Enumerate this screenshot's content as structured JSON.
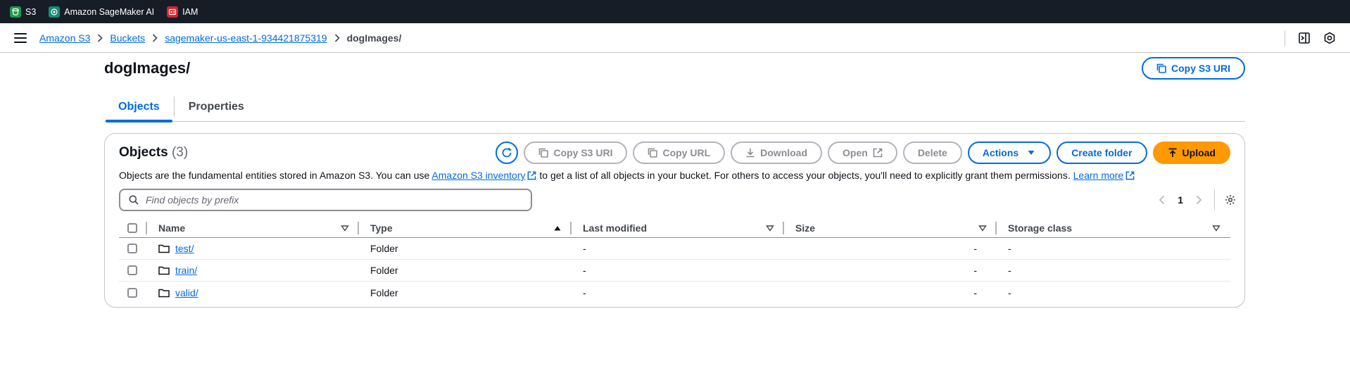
{
  "topbar": {
    "services": [
      {
        "label": "S3",
        "icon": "s3-icon",
        "color": "#1b9a4b"
      },
      {
        "label": "Amazon SageMaker AI",
        "icon": "sagemaker-icon",
        "color": "#158c77"
      },
      {
        "label": "IAM",
        "icon": "iam-icon",
        "color": "#d6242d"
      }
    ]
  },
  "breadcrumb": {
    "items": [
      "Amazon S3",
      "Buckets",
      "sagemaker-us-east-1-934421875319"
    ],
    "current": "dogImages/"
  },
  "page": {
    "title": "dogImages/",
    "copy_uri_label": "Copy S3 URI"
  },
  "tabs": [
    {
      "label": "Objects",
      "active": true
    },
    {
      "label": "Properties",
      "active": false
    }
  ],
  "objects_panel": {
    "title": "Objects",
    "count": "(3)",
    "toolbar": {
      "copy_s3_uri": "Copy S3 URI",
      "copy_url": "Copy URL",
      "download": "Download",
      "open": "Open",
      "delete": "Delete",
      "actions": "Actions",
      "create_folder": "Create folder",
      "upload": "Upload"
    },
    "description_pre": "Objects are the fundamental entities stored in Amazon S3. You can use ",
    "inventory_link": "Amazon S3 inventory",
    "description_post": " to get a list of all objects in your bucket. For others to access your objects, you'll need to explicitly grant them permissions. ",
    "learn_more": "Learn more",
    "search_placeholder": "Find objects by prefix",
    "page_number": "1"
  },
  "table": {
    "columns": [
      "Name",
      "Type",
      "Last modified",
      "Size",
      "Storage class"
    ],
    "rows": [
      {
        "name": "test/",
        "type": "Folder",
        "last_modified": "-",
        "size": "-",
        "storage_class": "-"
      },
      {
        "name": "train/",
        "type": "Folder",
        "last_modified": "-",
        "size": "-",
        "storage_class": "-"
      },
      {
        "name": "valid/",
        "type": "Folder",
        "last_modified": "-",
        "size": "-",
        "storage_class": "-"
      }
    ]
  },
  "colors": {
    "link": "#006ce0",
    "primary_button": "#ff9900",
    "topbar_bg": "#161d26"
  }
}
